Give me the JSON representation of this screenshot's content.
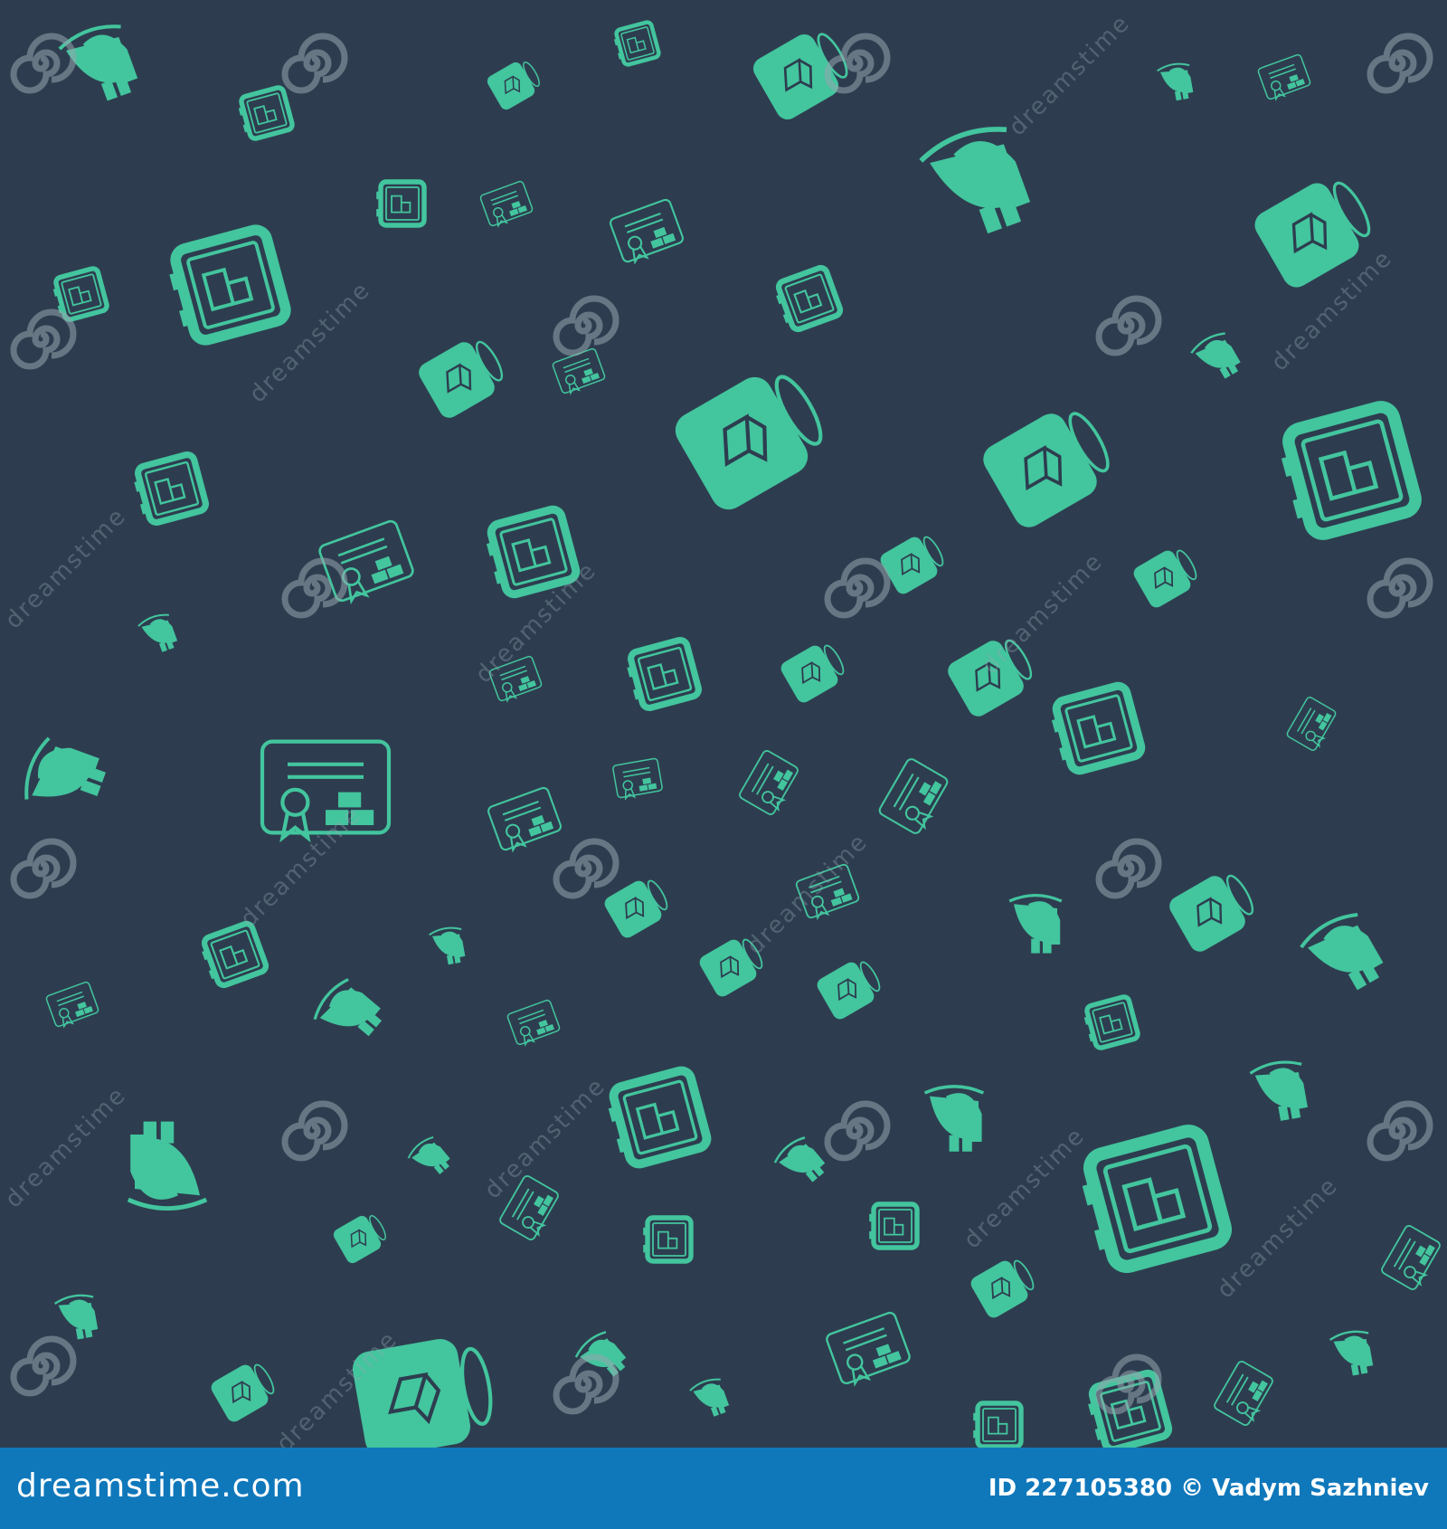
{
  "watermark": {
    "text": "dreamstime",
    "icon": "spiral-watermark-icon"
  },
  "footer": {
    "logo_text": "dreamstime.com",
    "image_id": "ID 227105380",
    "copyright": "©",
    "author": "Vadym Sazhniev"
  },
  "colors": {
    "background": "#2d3d4f",
    "icon": "#43c59e",
    "footer": "#0f78bb",
    "watermark": "#9aa8b0"
  },
  "icons": [
    "safe-icon",
    "gold-bar-speech-bubble-icon",
    "gold-certificate-icon",
    "molten-gold-pouring-icon"
  ]
}
